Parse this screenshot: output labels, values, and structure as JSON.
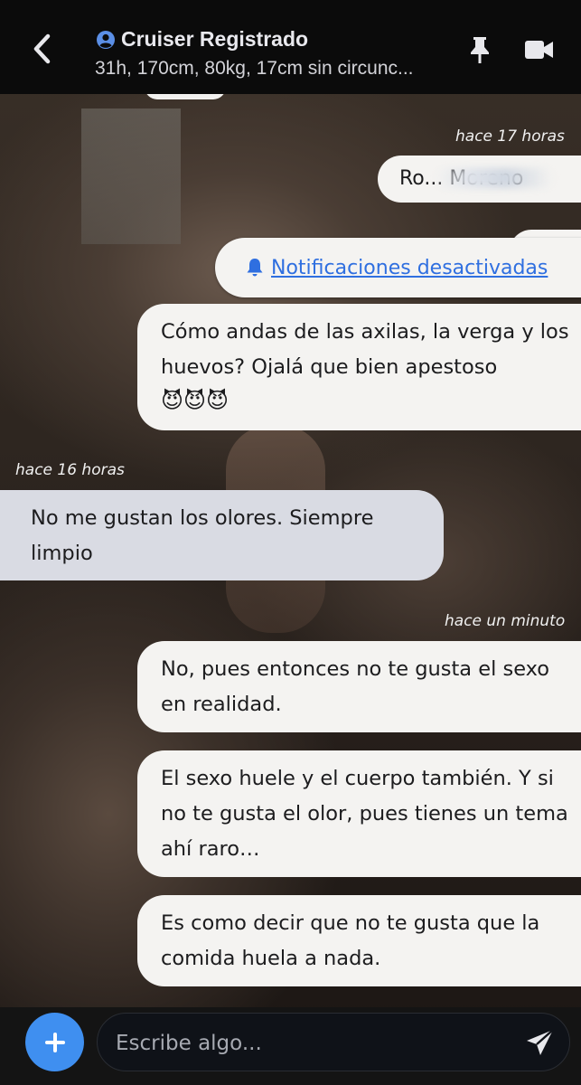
{
  "header": {
    "title": "Cruiser Registrado",
    "subtitle": "31h, 170cm, 80kg, 17cm sin circunc..."
  },
  "messages": {
    "ts1": "hace 17 horas",
    "name_bubble": "Ro... Moreno",
    "notification_link": "Notificaciones desactivadas",
    "m1": "Cómo andas de las axilas, la verga y los huevos? Ojalá que bien apestoso",
    "m1_emoji": "😈😈😈",
    "ts2": "hace 16 horas",
    "m2": "No me gustan los olores. Siempre limpio",
    "ts3": "hace un minuto",
    "m3": "No, pues entonces no te gusta el sexo en realidad.",
    "m4": "El sexo huele y el cuerpo también. Y si no te gusta el olor, pues tienes un tema ahí raro…",
    "m5": "Es como decir que no te gusta que la comida huela a nada."
  },
  "composer": {
    "placeholder": "Escribe algo..."
  },
  "colors": {
    "accent": "#3f8ff0",
    "link": "#2f6fe0",
    "outgoing_bubble": "#f4f3f1",
    "incoming_bubble": "#d9dbe3"
  },
  "icons": [
    "chevron-left-icon",
    "user-circle-icon",
    "pin-icon",
    "video-camera-icon",
    "bell-icon",
    "plus-icon",
    "send-icon"
  ]
}
